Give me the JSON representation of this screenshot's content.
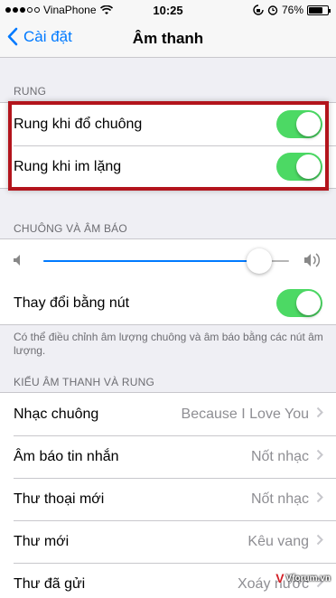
{
  "status": {
    "carrier": "VinaPhone",
    "time": "10:25",
    "battery_text": "76%",
    "battery_level": 0.76
  },
  "nav": {
    "back_label": "Cài đặt",
    "title": "Âm thanh"
  },
  "sections": {
    "rung": {
      "header": "RUNG",
      "rows": [
        {
          "label": "Rung khi đổ chuông",
          "on": true
        },
        {
          "label": "Rung khi im lặng",
          "on": true
        }
      ]
    },
    "chuong": {
      "header": "CHUÔNG VÀ ÂM BÁO",
      "volume_level": 0.88,
      "change_with_buttons_label": "Thay đổi bằng nút",
      "change_with_buttons_on": true,
      "footer": "Có thể điều chỉnh âm lượng chuông và âm báo bằng các nút âm lượng."
    },
    "kieu": {
      "header": "KIỂU ÂM THANH VÀ RUNG",
      "rows": [
        {
          "label": "Nhạc chuông",
          "value": "Because I Love You"
        },
        {
          "label": "Âm báo tin nhắn",
          "value": "Nốt nhạc"
        },
        {
          "label": "Thư thoại mới",
          "value": "Nốt nhạc"
        },
        {
          "label": "Thư mới",
          "value": "Kêu vang"
        },
        {
          "label": "Thư đã gửi",
          "value": "Xoáy nước"
        }
      ]
    }
  },
  "watermark": {
    "logo": "V",
    "text": "Vforum.vn"
  },
  "colors": {
    "accent": "#007aff",
    "toggle_on": "#4cd964",
    "highlight": "#b3141c"
  },
  "icons": [
    "signal-dots-icon",
    "wifi-icon",
    "alarm-icon",
    "lock-rotation-icon",
    "battery-icon",
    "back-chevron-icon",
    "volume-low-icon",
    "volume-high-icon",
    "chevron-right-icon"
  ]
}
